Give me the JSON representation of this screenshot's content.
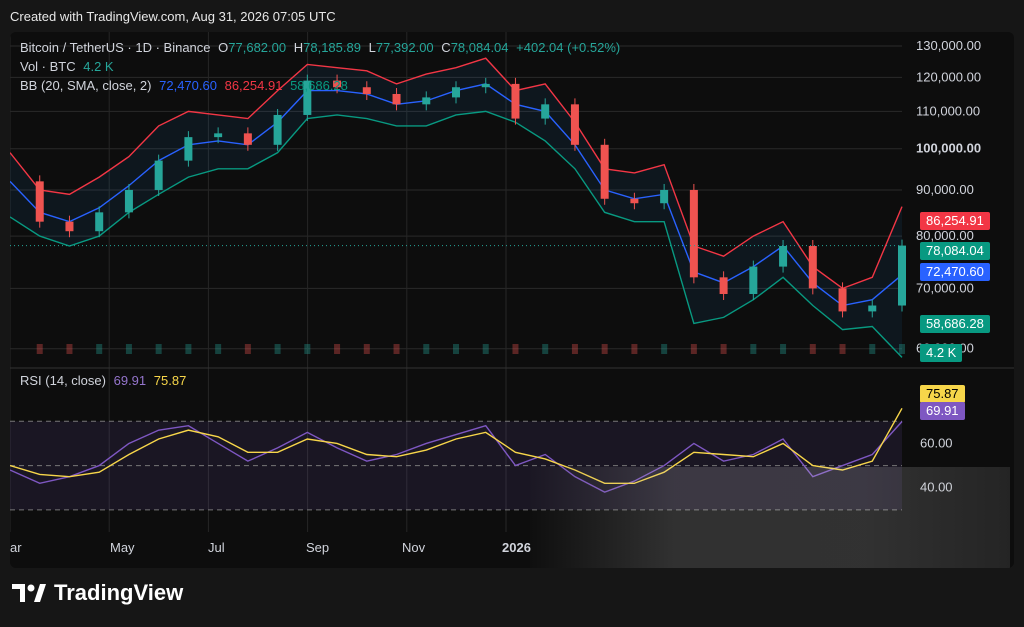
{
  "caption": "Created with TradingView.com, Aug 31, 2026 07:05 UTC",
  "brand": "TradingView",
  "legend": {
    "symbol": "Bitcoin / TetherUS · 1D · Binance",
    "open_label": "O",
    "open": "77,682.00",
    "high_label": "H",
    "high": "78,185.89",
    "low_label": "L",
    "low": "77,392.00",
    "close_label": "C",
    "close": "78,084.04",
    "change": "+402.04 (+0.52%)",
    "vol_label": "Vol · BTC",
    "vol": "4.2 K",
    "bb_label": "BB (20, SMA, close, 2)",
    "bb_mid": "72,470.60",
    "bb_upper": "86,254.91",
    "bb_lower": "58,686.28",
    "rsi_label": "RSI (14, close)",
    "rsi": "69.91",
    "rsi_ma": "75.87"
  },
  "tags": {
    "upper": "86,254.91",
    "price": "78,084.04",
    "mid": "72,470.60",
    "lower": "58,686.28",
    "vol": "4.2 K",
    "rsi_ma": "75.87",
    "rsi": "69.91"
  },
  "colors": {
    "up": "#26a69a",
    "down": "#ef5350",
    "bb_mid": "#2962ff",
    "bb_upper": "#f23645",
    "bb_lower": "#089981",
    "rsi": "#7e57c2",
    "rsi_ma": "#f7d64a",
    "price_tag": "#089981"
  },
  "chart_data": {
    "type": "line",
    "title": "Bitcoin / TetherUS · 1D · Binance",
    "x_labels": [
      "ar",
      "May",
      "Jul",
      "Sep",
      "Nov",
      "2026"
    ],
    "y_ticks": [
      "130,000.00",
      "120,000.00",
      "110,000.00",
      "100,000.00",
      "90,000.00",
      "80,000.00",
      "70,000.00",
      "60,000.00"
    ],
    "ylim": [
      58000,
      132000
    ],
    "log_scale": true,
    "rsi_ticks": [
      "60.00",
      "40.00"
    ],
    "rsi_lim": [
      20,
      90
    ],
    "series": [
      {
        "name": "Bitcoin / TetherUS",
        "x": [
          0,
          3,
          6,
          9,
          12,
          15,
          18,
          21,
          24,
          27,
          30,
          33,
          36,
          39,
          42,
          45,
          48,
          51,
          54,
          57,
          60,
          63,
          66,
          69,
          72,
          75,
          78,
          81,
          84,
          87,
          90
        ],
        "values": [
          92000,
          83000,
          81000,
          85000,
          90000,
          97000,
          103000,
          104000,
          101000,
          109000,
          119000,
          117000,
          115000,
          112000,
          114000,
          117000,
          118000,
          108000,
          112000,
          101000,
          88000,
          87000,
          90000,
          72000,
          69000,
          74000,
          78000,
          70000,
          66000,
          67000,
          78084
        ]
      },
      {
        "name": "BB upper",
        "x": [
          0,
          3,
          6,
          9,
          12,
          15,
          18,
          21,
          24,
          27,
          30,
          33,
          36,
          39,
          42,
          45,
          48,
          51,
          54,
          57,
          60,
          63,
          66,
          69,
          72,
          75,
          78,
          81,
          84,
          87,
          90
        ],
        "values": [
          99000,
          90000,
          89000,
          93000,
          98000,
          106000,
          110000,
          109000,
          108000,
          116000,
          124000,
          123000,
          122000,
          118000,
          121000,
          123000,
          126000,
          116000,
          118000,
          107000,
          95000,
          94000,
          96000,
          78000,
          76000,
          80000,
          83000,
          74000,
          70000,
          72000,
          86254.91
        ]
      },
      {
        "name": "BB (20, SMA, close, 2)",
        "x": [
          0,
          3,
          6,
          9,
          12,
          15,
          18,
          21,
          24,
          27,
          30,
          33,
          36,
          39,
          42,
          45,
          48,
          51,
          54,
          57,
          60,
          63,
          66,
          69,
          72,
          75,
          78,
          81,
          84,
          87,
          90
        ],
        "values": [
          92000,
          85000,
          83000,
          86000,
          91000,
          97000,
          101000,
          102000,
          101000,
          107000,
          116000,
          116000,
          115000,
          112000,
          113000,
          116000,
          118000,
          112000,
          110000,
          101000,
          90000,
          88000,
          89000,
          73000,
          71000,
          74000,
          78000,
          71000,
          67000,
          68000,
          72470.6
        ]
      },
      {
        "name": "BB lower",
        "x": [
          0,
          3,
          6,
          9,
          12,
          15,
          18,
          21,
          24,
          27,
          30,
          33,
          36,
          39,
          42,
          45,
          48,
          51,
          54,
          57,
          60,
          63,
          66,
          69,
          72,
          75,
          78,
          81,
          84,
          87,
          90
        ],
        "values": [
          84000,
          80000,
          78000,
          80000,
          85000,
          89000,
          93000,
          95000,
          95000,
          99000,
          108000,
          109000,
          108000,
          106000,
          106000,
          109000,
          110000,
          107000,
          102000,
          95000,
          85000,
          83000,
          83000,
          64000,
          65000,
          68000,
          72000,
          67000,
          63000,
          63500,
          58686.28
        ]
      }
    ],
    "rsi_series": [
      {
        "name": "RSI (14, close)",
        "x": [
          0,
          3,
          6,
          9,
          12,
          15,
          18,
          21,
          24,
          27,
          30,
          33,
          36,
          39,
          42,
          45,
          48,
          51,
          54,
          57,
          60,
          63,
          66,
          69,
          72,
          75,
          78,
          81,
          84,
          87,
          90
        ],
        "values": [
          48,
          42,
          45,
          50,
          60,
          66,
          68,
          60,
          52,
          58,
          65,
          58,
          52,
          55,
          60,
          64,
          68,
          50,
          55,
          45,
          38,
          43,
          50,
          60,
          52,
          55,
          62,
          45,
          50,
          55,
          69.91
        ]
      },
      {
        "name": "RSI MA",
        "x": [
          0,
          3,
          6,
          9,
          12,
          15,
          18,
          21,
          24,
          27,
          30,
          33,
          36,
          39,
          42,
          45,
          48,
          51,
          54,
          57,
          60,
          63,
          66,
          69,
          72,
          75,
          78,
          81,
          84,
          87,
          90
        ],
        "values": [
          50,
          46,
          45,
          47,
          55,
          62,
          66,
          63,
          56,
          56,
          62,
          60,
          55,
          54,
          57,
          62,
          65,
          56,
          53,
          48,
          42,
          42,
          47,
          56,
          55,
          54,
          60,
          50,
          48,
          52,
          75.87
        ]
      }
    ]
  }
}
